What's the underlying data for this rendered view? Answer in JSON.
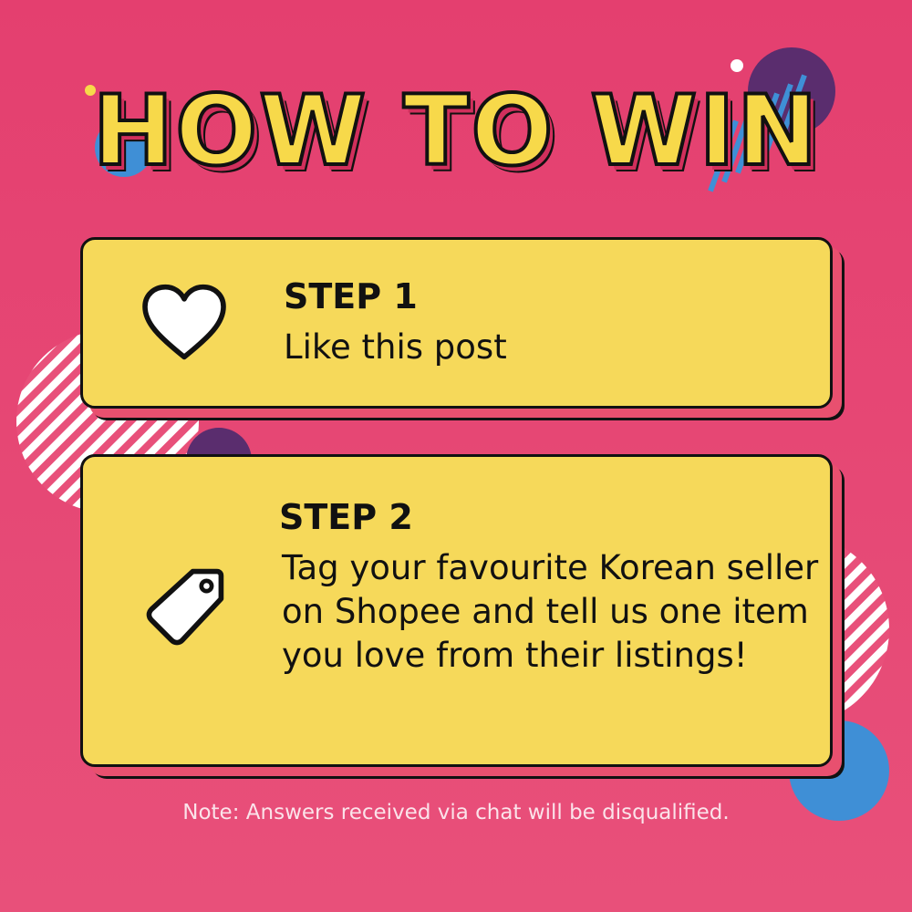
{
  "heading": {
    "text": "HOW TO WIN"
  },
  "steps": [
    {
      "title": "STEP 1",
      "text": "Like this post",
      "icon": "heart-icon"
    },
    {
      "title": "STEP 2",
      "text": "Tag your favourite Korean seller on Shopee and tell us one item you love from their listings!",
      "icon": "tag-icon"
    }
  ],
  "note": {
    "text": "Note: Answers received via chat will be disqualified."
  },
  "colors": {
    "background": "#e43f6f",
    "card": "#f6d95a",
    "title_fill": "#f7d94a",
    "outline": "#111111",
    "accent_blue": "#3f8fd6",
    "accent_purple": "#5a2d6e"
  }
}
